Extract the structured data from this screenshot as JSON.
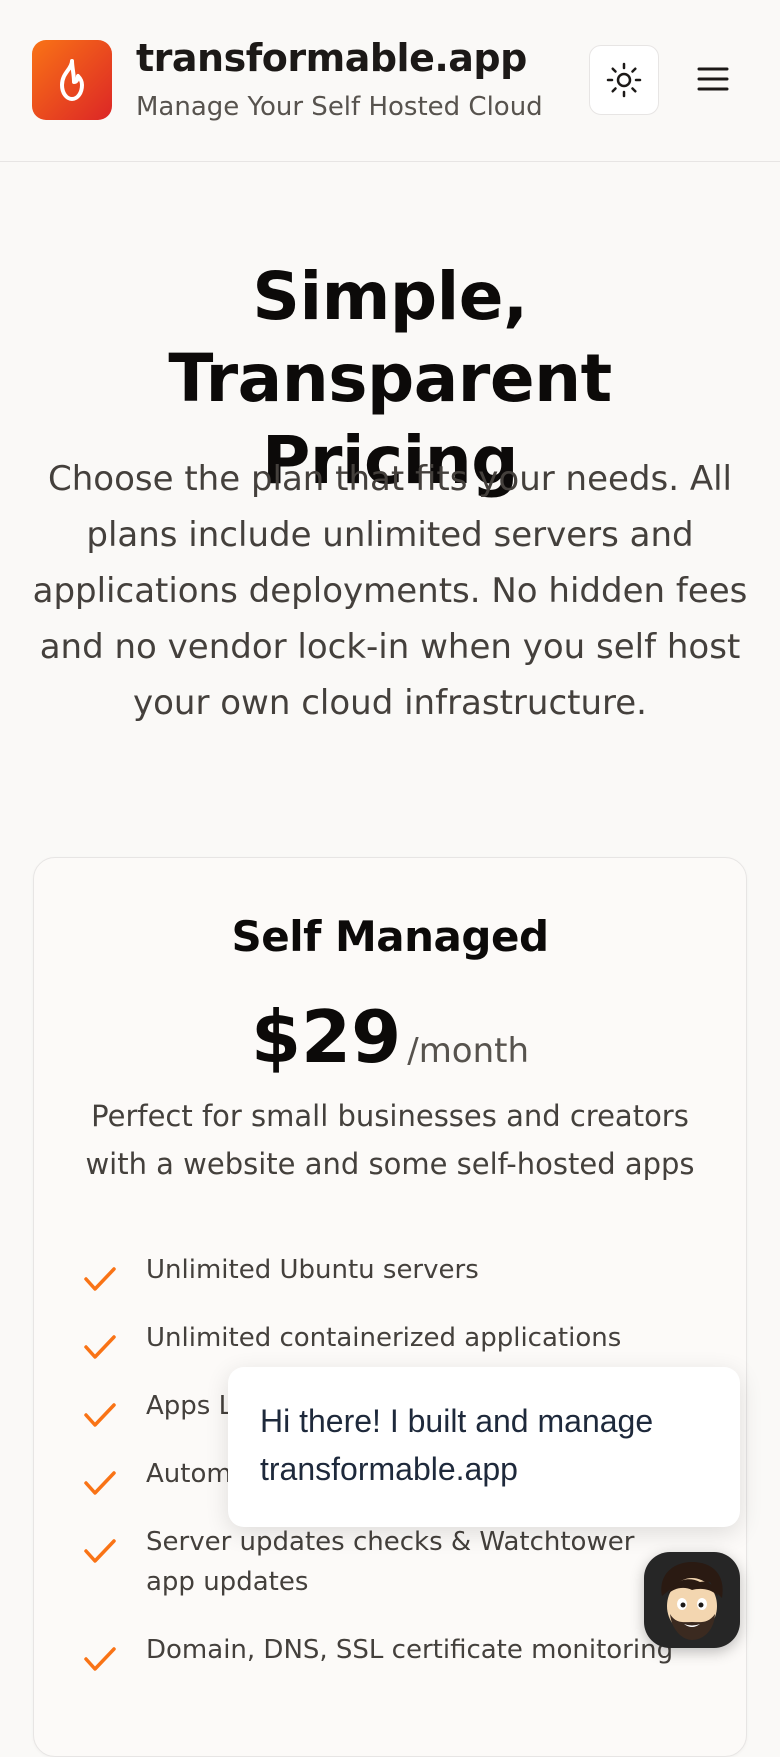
{
  "header": {
    "brand_title": "transformable.app",
    "brand_subtitle": "Manage Your Self Hosted Cloud",
    "logo_icon": "flame-icon",
    "theme_toggle_icon": "sun-icon",
    "menu_icon": "hamburger-menu-icon"
  },
  "hero": {
    "title": "Simple, Transparent Pricing",
    "description": "Choose the plan that fits your needs. All plans include unlimited servers and applications deployments. No hidden fees and no vendor lock-in when you self host your own cloud infrastructure."
  },
  "plan": {
    "name": "Self Managed",
    "price": "$29",
    "period": "/month",
    "description": "Perfect for small businesses and creators with a website and some self-hosted apps",
    "features": [
      "Unlimited Ubuntu servers",
      "Unlimited containerized applications",
      "Apps L",
      "Autom",
      "Server updates checks & Watchtower app updates",
      "Domain, DNS, SSL certificate monitoring"
    ]
  },
  "chat": {
    "message": "Hi there! I built and manage transformable.app",
    "avatar_icon": "cartoon-avatar-icon"
  },
  "colors": {
    "accent": "#f97316",
    "logo_gradient_end": "#dc2626",
    "background": "#faf9f7",
    "card_background": "#fcfaf8"
  }
}
